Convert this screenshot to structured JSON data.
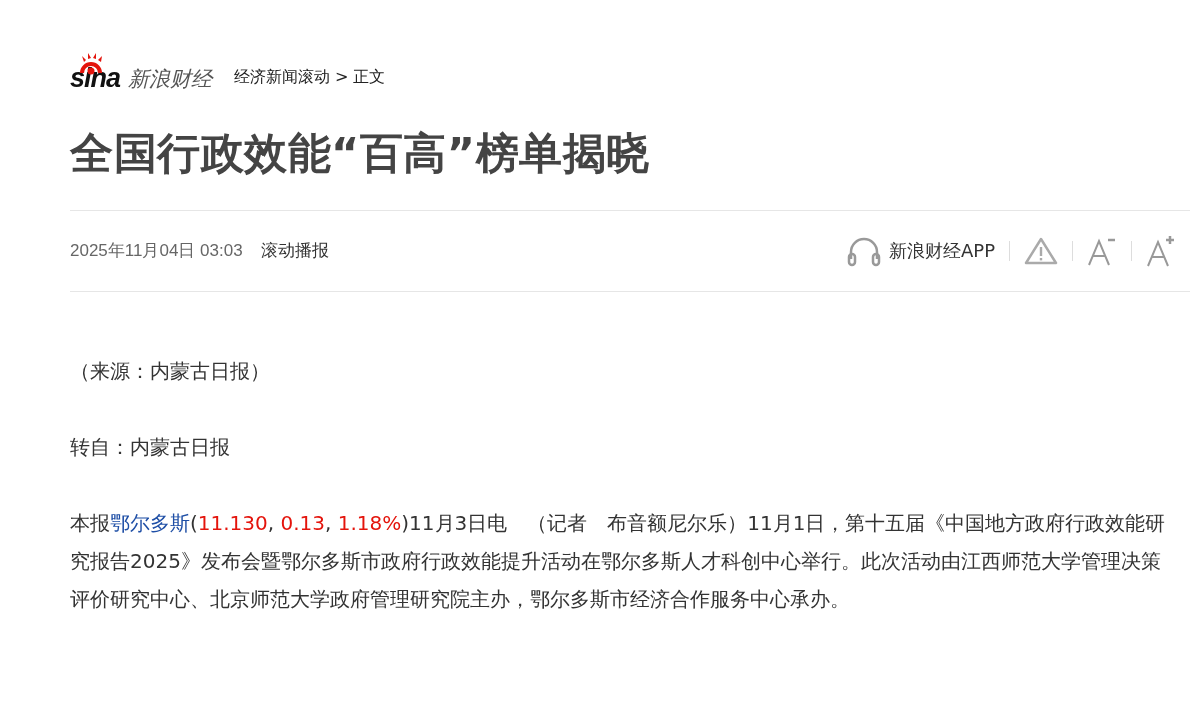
{
  "header": {
    "logo_text": "sina",
    "channel": "新浪财经",
    "breadcrumb": [
      {
        "label": "经济新闻滚动"
      },
      {
        "label": "正文"
      }
    ],
    "separator": ">"
  },
  "article": {
    "title": "全国行政效能“百高”榜单揭晓",
    "date": "2025年11月04日 03:03",
    "source": "滚动播报",
    "toolbar": [
      {
        "kind": "app",
        "label": "新浪财经APP"
      },
      {
        "kind": "report"
      },
      {
        "kind": "font_smaller"
      },
      {
        "kind": "font_larger"
      }
    ],
    "source_note": "（来源：内蒙古日报）",
    "reprint": "转自：内蒙古日报",
    "paragraph": [
      {
        "kind": "text",
        "text": "本报"
      },
      {
        "kind": "link",
        "text": "鄂尔多斯"
      },
      {
        "kind": "text",
        "text": "("
      },
      {
        "kind": "quote",
        "text": "11.130"
      },
      {
        "kind": "text",
        "text": ", "
      },
      {
        "kind": "quote",
        "text": "0.13"
      },
      {
        "kind": "text",
        "text": ", "
      },
      {
        "kind": "quote",
        "text": "1.18%"
      },
      {
        "kind": "text",
        "text": ")11月3日电　（记者　布音额尼尔乐）11月1日，第十五届《中国地方政府行政效能研究报告2025》发布会暨鄂尔多斯市政府行政效能提升活动在鄂尔多斯人才科创中心举行。此次活动由江西师范大学管理决策评价研究中心、北京师范大学政府管理研究院主办，鄂尔多斯市经济合作服务中心承办。"
      }
    ]
  }
}
